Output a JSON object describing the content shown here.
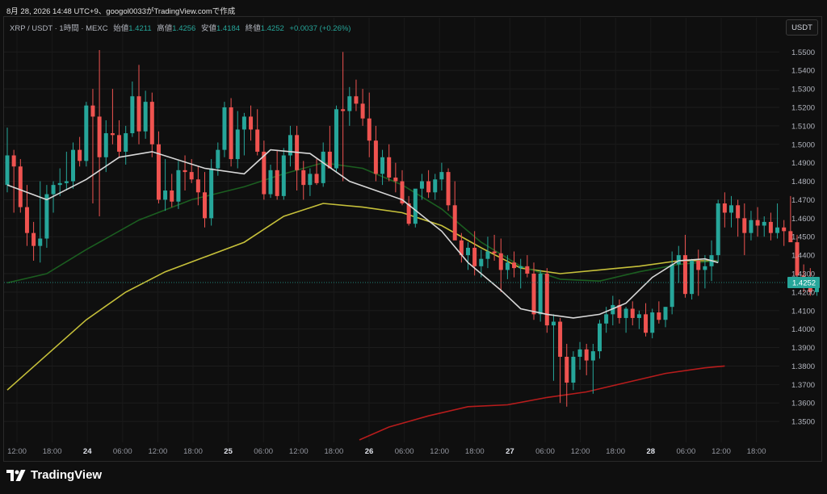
{
  "caption": "8月 28, 2026 14:48 UTC+9、googol0033がTradingView.comで作成",
  "symbol": {
    "pair": "XRP / USDT · 1時間 · MEXC",
    "open_label": "始値",
    "open": "1.4211",
    "high_label": "高値",
    "high": "1.4256",
    "low_label": "安値",
    "low": "1.4184",
    "close_label": "終値",
    "close": "1.4252",
    "change": "+0.0037 (+0.26%)"
  },
  "currency": "USDT",
  "footer": {
    "brand": "TradingView"
  },
  "colors": {
    "up": "#26a69a",
    "down": "#ef5350",
    "ma_white": "#d8d8d8",
    "ma_green": "#1b5e20",
    "ma_yellow": "#c6c03a",
    "ma_red": "#b71c1c",
    "price_tag": "#26a69a"
  },
  "chart_data": {
    "type": "candlestick",
    "y_axis": {
      "min": 1.34,
      "max": 1.565,
      "ticks": [
        "1.5500",
        "1.5400",
        "1.5300",
        "1.5200",
        "1.5100",
        "1.5000",
        "1.4900",
        "1.4800",
        "1.4700",
        "1.4600",
        "1.4500",
        "1.4400",
        "1.4300",
        "1.4200",
        "1.4100",
        "1.4000",
        "1.3900",
        "1.3800",
        "1.3700",
        "1.3600",
        "1.3500"
      ],
      "last_price": "1.4252"
    },
    "x_axis": {
      "labels": [
        "12:00",
        "18:00",
        "24",
        "06:00",
        "12:00",
        "18:00",
        "25",
        "06:00",
        "12:00",
        "18:00",
        "26",
        "06:00",
        "12:00",
        "18:00",
        "27",
        "06:00",
        "12:00",
        "18:00",
        "28",
        "06:00",
        "12:00",
        "18:00"
      ],
      "bold": [
        "24",
        "25",
        "26",
        "27",
        "28"
      ],
      "hours_per_label": 6
    },
    "candles": [
      [
        1.478,
        1.509,
        1.474,
        1.494
      ],
      [
        1.494,
        1.497,
        1.463,
        1.488
      ],
      [
        1.488,
        1.492,
        1.463,
        1.466
      ],
      [
        1.466,
        1.478,
        1.445,
        1.452
      ],
      [
        1.452,
        1.458,
        1.437,
        1.445
      ],
      [
        1.445,
        1.48,
        1.436,
        1.449
      ],
      [
        1.449,
        1.478,
        1.444,
        1.473
      ],
      [
        1.473,
        1.48,
        1.463,
        1.478
      ],
      [
        1.478,
        1.487,
        1.472,
        1.479
      ],
      [
        1.479,
        1.496,
        1.475,
        1.48
      ],
      [
        1.48,
        1.501,
        1.476,
        1.497
      ],
      [
        1.497,
        1.504,
        1.488,
        1.491
      ],
      [
        1.491,
        1.523,
        1.488,
        1.521
      ],
      [
        1.521,
        1.53,
        1.468,
        1.515
      ],
      [
        1.515,
        1.551,
        1.461,
        1.493
      ],
      [
        1.493,
        1.513,
        1.485,
        1.506
      ],
      [
        1.506,
        1.53,
        1.5,
        1.505
      ],
      [
        1.505,
        1.513,
        1.493,
        1.496
      ],
      [
        1.496,
        1.51,
        1.489,
        1.506
      ],
      [
        1.506,
        1.534,
        1.504,
        1.526
      ],
      [
        1.526,
        1.543,
        1.5,
        1.507
      ],
      [
        1.507,
        1.529,
        1.503,
        1.523
      ],
      [
        1.523,
        1.528,
        1.493,
        1.5
      ],
      [
        1.5,
        1.507,
        1.468,
        1.47
      ],
      [
        1.47,
        1.492,
        1.464,
        1.475
      ],
      [
        1.475,
        1.484,
        1.466,
        1.469
      ],
      [
        1.469,
        1.491,
        1.465,
        1.486
      ],
      [
        1.486,
        1.494,
        1.475,
        1.485
      ],
      [
        1.485,
        1.492,
        1.479,
        1.481
      ],
      [
        1.481,
        1.488,
        1.467,
        1.474
      ],
      [
        1.474,
        1.485,
        1.455,
        1.46
      ],
      [
        1.46,
        1.492,
        1.456,
        1.487
      ],
      [
        1.487,
        1.501,
        1.483,
        1.497
      ],
      [
        1.497,
        1.523,
        1.493,
        1.52
      ],
      [
        1.52,
        1.525,
        1.488,
        1.492
      ],
      [
        1.492,
        1.518,
        1.487,
        1.508
      ],
      [
        1.508,
        1.517,
        1.494,
        1.515
      ],
      [
        1.515,
        1.521,
        1.502,
        1.508
      ],
      [
        1.508,
        1.519,
        1.494,
        1.496
      ],
      [
        1.496,
        1.502,
        1.47,
        1.473
      ],
      [
        1.473,
        1.489,
        1.471,
        1.486
      ],
      [
        1.486,
        1.497,
        1.47,
        1.472
      ],
      [
        1.472,
        1.498,
        1.47,
        1.494
      ],
      [
        1.494,
        1.51,
        1.488,
        1.505
      ],
      [
        1.505,
        1.51,
        1.475,
        1.486
      ],
      [
        1.486,
        1.491,
        1.47,
        1.478
      ],
      [
        1.478,
        1.487,
        1.472,
        1.484
      ],
      [
        1.484,
        1.492,
        1.478,
        1.479
      ],
      [
        1.479,
        1.501,
        1.477,
        1.496
      ],
      [
        1.496,
        1.51,
        1.49,
        1.487
      ],
      [
        1.487,
        1.521,
        1.485,
        1.519
      ],
      [
        1.519,
        1.55,
        1.48,
        1.518
      ],
      [
        1.518,
        1.531,
        1.51,
        1.526
      ],
      [
        1.526,
        1.535,
        1.518,
        1.522
      ],
      [
        1.522,
        1.53,
        1.51,
        1.514
      ],
      [
        1.514,
        1.528,
        1.493,
        1.502
      ],
      [
        1.502,
        1.51,
        1.48,
        1.484
      ],
      [
        1.484,
        1.497,
        1.478,
        1.493
      ],
      [
        1.493,
        1.5,
        1.48,
        1.482
      ],
      [
        1.482,
        1.49,
        1.474,
        1.48
      ],
      [
        1.48,
        1.486,
        1.467,
        1.468
      ],
      [
        1.468,
        1.472,
        1.456,
        1.457
      ],
      [
        1.457,
        1.47,
        1.455,
        1.476
      ],
      [
        1.476,
        1.484,
        1.47,
        1.48
      ],
      [
        1.48,
        1.486,
        1.471,
        1.474
      ],
      [
        1.474,
        1.484,
        1.47,
        1.481
      ],
      [
        1.481,
        1.49,
        1.475,
        1.485
      ],
      [
        1.485,
        1.487,
        1.464,
        1.467
      ],
      [
        1.467,
        1.48,
        1.462,
        1.448
      ],
      [
        1.448,
        1.452,
        1.436,
        1.44
      ],
      [
        1.44,
        1.447,
        1.432,
        1.444
      ],
      [
        1.444,
        1.453,
        1.429,
        1.434
      ],
      [
        1.434,
        1.443,
        1.428,
        1.438
      ],
      [
        1.438,
        1.45,
        1.433,
        1.442
      ],
      [
        1.442,
        1.451,
        1.437,
        1.441
      ],
      [
        1.441,
        1.449,
        1.42,
        1.432
      ],
      [
        1.432,
        1.44,
        1.427,
        1.436
      ],
      [
        1.436,
        1.442,
        1.428,
        1.433
      ],
      [
        1.433,
        1.438,
        1.422,
        1.434
      ],
      [
        1.434,
        1.44,
        1.428,
        1.43
      ],
      [
        1.43,
        1.436,
        1.405,
        1.408
      ],
      [
        1.408,
        1.432,
        1.404,
        1.43
      ],
      [
        1.43,
        1.433,
        1.398,
        1.402
      ],
      [
        1.402,
        1.408,
        1.372,
        1.404
      ],
      [
        1.404,
        1.406,
        1.36,
        1.385
      ],
      [
        1.385,
        1.392,
        1.358,
        1.371
      ],
      [
        1.371,
        1.388,
        1.367,
        1.385
      ],
      [
        1.385,
        1.393,
        1.378,
        1.389
      ],
      [
        1.389,
        1.392,
        1.375,
        1.383
      ],
      [
        1.383,
        1.392,
        1.365,
        1.388
      ],
      [
        1.388,
        1.405,
        1.384,
        1.403
      ],
      [
        1.403,
        1.412,
        1.398,
        1.408
      ],
      [
        1.408,
        1.418,
        1.402,
        1.413
      ],
      [
        1.413,
        1.416,
        1.403,
        1.406
      ],
      [
        1.406,
        1.412,
        1.398,
        1.411
      ],
      [
        1.411,
        1.415,
        1.402,
        1.406
      ],
      [
        1.406,
        1.41,
        1.4,
        1.408
      ],
      [
        1.408,
        1.414,
        1.396,
        1.398
      ],
      [
        1.398,
        1.411,
        1.395,
        1.409
      ],
      [
        1.409,
        1.415,
        1.403,
        1.405
      ],
      [
        1.405,
        1.412,
        1.401,
        1.412
      ],
      [
        1.412,
        1.442,
        1.408,
        1.435
      ],
      [
        1.435,
        1.445,
        1.425,
        1.44
      ],
      [
        1.44,
        1.451,
        1.417,
        1.419
      ],
      [
        1.419,
        1.438,
        1.416,
        1.437
      ],
      [
        1.437,
        1.443,
        1.418,
        1.432
      ],
      [
        1.432,
        1.44,
        1.422,
        1.434
      ],
      [
        1.434,
        1.448,
        1.426,
        1.44
      ],
      [
        1.44,
        1.47,
        1.436,
        1.468
      ],
      [
        1.468,
        1.474,
        1.455,
        1.463
      ],
      [
        1.463,
        1.472,
        1.455,
        1.467
      ],
      [
        1.467,
        1.47,
        1.45,
        1.46
      ],
      [
        1.46,
        1.468,
        1.44,
        1.452
      ],
      [
        1.452,
        1.464,
        1.448,
        1.459
      ],
      [
        1.459,
        1.466,
        1.45,
        1.456
      ],
      [
        1.456,
        1.461,
        1.45,
        1.458
      ],
      [
        1.458,
        1.463,
        1.448,
        1.452
      ],
      [
        1.452,
        1.468,
        1.449,
        1.455
      ],
      [
        1.455,
        1.459,
        1.445,
        1.453
      ],
      [
        1.453,
        1.472,
        1.449,
        1.447
      ],
      [
        1.447,
        1.451,
        1.425,
        1.429
      ],
      [
        1.429,
        1.435,
        1.42,
        1.425
      ],
      [
        1.425,
        1.433,
        1.418,
        1.42
      ],
      [
        1.42,
        1.426,
        1.418,
        1.4252
      ]
    ],
    "ma_white": [
      [
        0,
        1.478
      ],
      [
        6,
        1.47
      ],
      [
        12,
        1.481
      ],
      [
        17,
        1.493
      ],
      [
        22,
        1.496
      ],
      [
        30,
        1.487
      ],
      [
        36,
        1.484
      ],
      [
        40,
        1.497
      ],
      [
        46,
        1.495
      ],
      [
        52,
        1.48
      ],
      [
        60,
        1.47
      ],
      [
        66,
        1.453
      ],
      [
        70,
        1.436
      ],
      [
        75,
        1.421
      ],
      [
        78,
        1.411
      ],
      [
        82,
        1.408
      ],
      [
        86,
        1.406
      ],
      [
        90,
        1.408
      ],
      [
        94,
        1.414
      ],
      [
        98,
        1.428
      ],
      [
        102,
        1.437
      ],
      [
        106,
        1.438
      ],
      [
        108,
        1.436
      ]
    ],
    "ma_green": [
      [
        0,
        1.425
      ],
      [
        6,
        1.43
      ],
      [
        12,
        1.443
      ],
      [
        20,
        1.459
      ],
      [
        28,
        1.47
      ],
      [
        36,
        1.477
      ],
      [
        42,
        1.484
      ],
      [
        48,
        1.49
      ],
      [
        54,
        1.487
      ],
      [
        60,
        1.478
      ],
      [
        66,
        1.465
      ],
      [
        72,
        1.447
      ],
      [
        78,
        1.434
      ],
      [
        84,
        1.427
      ],
      [
        90,
        1.426
      ],
      [
        96,
        1.431
      ],
      [
        102,
        1.435
      ],
      [
        108,
        1.437
      ]
    ],
    "ma_yellow": [
      [
        0,
        1.367
      ],
      [
        6,
        1.386
      ],
      [
        12,
        1.405
      ],
      [
        18,
        1.42
      ],
      [
        24,
        1.431
      ],
      [
        30,
        1.439
      ],
      [
        36,
        1.447
      ],
      [
        42,
        1.461
      ],
      [
        48,
        1.468
      ],
      [
        54,
        1.466
      ],
      [
        60,
        1.463
      ],
      [
        66,
        1.456
      ],
      [
        72,
        1.444
      ],
      [
        78,
        1.433
      ],
      [
        84,
        1.43
      ],
      [
        90,
        1.432
      ],
      [
        96,
        1.434
      ],
      [
        102,
        1.437
      ],
      [
        108,
        1.437
      ]
    ],
    "ma_red": [
      [
        53.5,
        1.34
      ],
      [
        58,
        1.347
      ],
      [
        64,
        1.353
      ],
      [
        70,
        1.358
      ],
      [
        76,
        1.359
      ],
      [
        82,
        1.363
      ],
      [
        88,
        1.366
      ],
      [
        94,
        1.371
      ],
      [
        100,
        1.376
      ],
      [
        106,
        1.379
      ],
      [
        109,
        1.38
      ]
    ]
  }
}
